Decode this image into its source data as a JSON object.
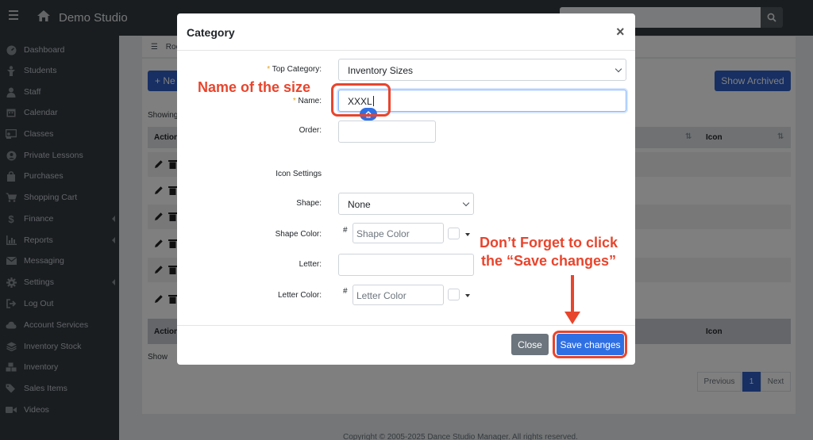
{
  "navbar": {
    "brand": "Demo Studio"
  },
  "sidebar": {
    "items": [
      {
        "label": "Dashboard",
        "icon": "dashboard-icon"
      },
      {
        "label": "Students",
        "icon": "student-icon"
      },
      {
        "label": "Staff",
        "icon": "user-icon"
      },
      {
        "label": "Calendar",
        "icon": "calendar-icon"
      },
      {
        "label": "Classes",
        "icon": "classes-icon"
      },
      {
        "label": "Private Lessons",
        "icon": "person-circle-icon"
      },
      {
        "label": "Purchases",
        "icon": "shopping-bag-icon"
      },
      {
        "label": "Shopping Cart",
        "icon": "cart-icon"
      },
      {
        "label": "Finance",
        "icon": "dollar-icon"
      },
      {
        "label": "Reports",
        "icon": "chart-icon"
      },
      {
        "label": "Messaging",
        "icon": "envelope-icon"
      },
      {
        "label": "Settings",
        "icon": "gear-icon"
      },
      {
        "label": "Log Out",
        "icon": "logout-icon"
      },
      {
        "label": "Account Services",
        "icon": "cloud-icon"
      },
      {
        "label": "Inventory Stock",
        "icon": "layers-icon"
      },
      {
        "label": "Inventory",
        "icon": "boxes-icon"
      },
      {
        "label": "Sales Items",
        "icon": "tags-icon"
      },
      {
        "label": "Videos",
        "icon": "video-icon"
      }
    ]
  },
  "page": {
    "breadcrumb": "Roo",
    "new_button": "+ Ne",
    "show_archived_button": "Show Archived",
    "showing_text": "Showing",
    "table": {
      "header_action": "Action",
      "header_icon": "Icon"
    },
    "show_label": "Show",
    "pagination": {
      "previous": "Previous",
      "current": "1",
      "next": "Next"
    },
    "footer": "Copyright © 2005-2025 Dance Studio Manager. All rights reserved."
  },
  "modal": {
    "title": "Category",
    "close_symbol": "×",
    "fields": {
      "top_category": {
        "label": "Top Category:",
        "value": "Inventory Sizes"
      },
      "name": {
        "label": "Name:",
        "value": "XXXL"
      },
      "order": {
        "label": "Order:",
        "value": ""
      },
      "icon_settings": {
        "label": "Icon Settings"
      },
      "shape": {
        "label": "Shape:",
        "value": "None"
      },
      "shape_color": {
        "label": "Shape Color:",
        "hash": "#",
        "placeholder": "Shape Color"
      },
      "letter": {
        "label": "Letter:",
        "value": ""
      },
      "letter_color": {
        "label": "Letter Color:",
        "hash": "#",
        "placeholder": "Letter Color"
      }
    },
    "required_mark": "*",
    "buttons": {
      "close": "Close",
      "save": "Save changes"
    }
  },
  "annotations": {
    "name_note": "Name of the size",
    "save_note_line1": "Don’t Forget to click",
    "save_note_line2": "the “Save changes”",
    "color": "#e8452d"
  },
  "colors": {
    "primary": "#2f6fe4",
    "sidebar_bg": "#343a40",
    "secondary_button": "#6c757d"
  }
}
